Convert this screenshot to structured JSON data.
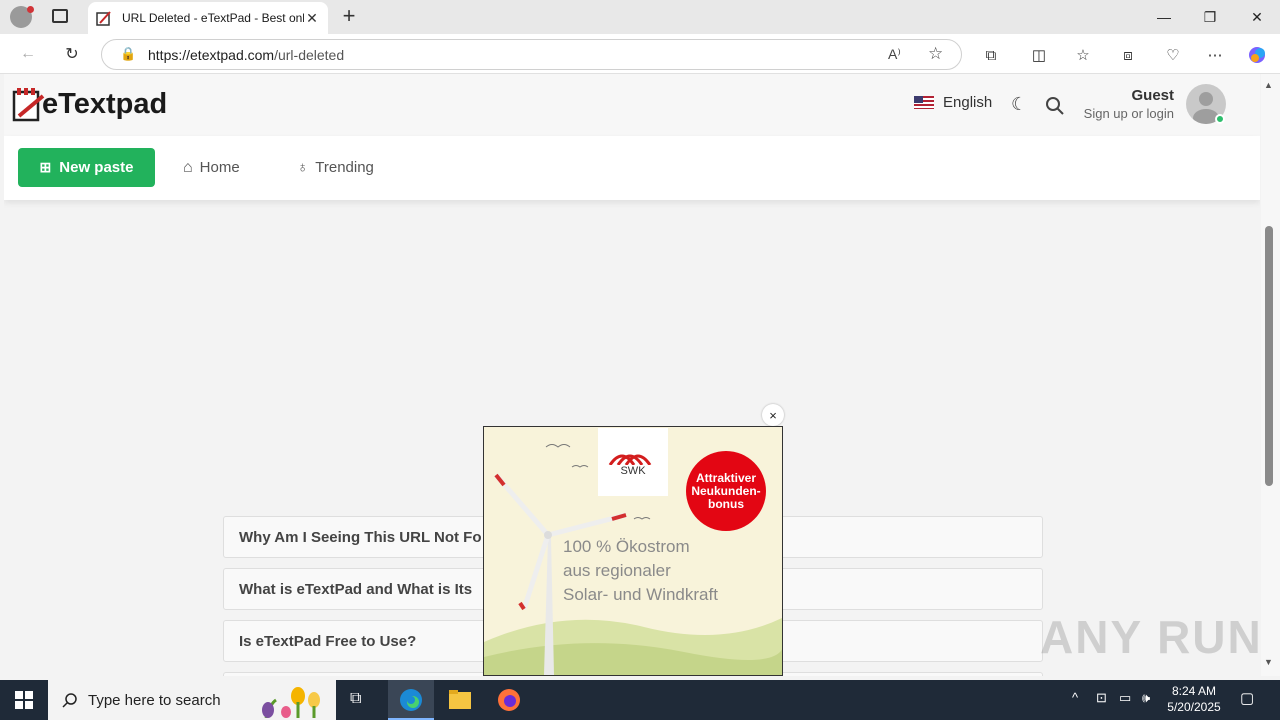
{
  "browser": {
    "tab_title": "URL Deleted - eTextPad - Best onl",
    "new_tab_symbol": "+",
    "url_host": "https://etextpad.com",
    "url_path": "/url-deleted"
  },
  "header": {
    "logo_text": "eTextpad",
    "language": "English",
    "user_name": "Guest",
    "user_sub": "Sign up or login"
  },
  "navbar": {
    "new_paste_label": "New paste",
    "home_label": "Home",
    "trending_label": "Trending"
  },
  "faq": [
    {
      "text": "Why Am I Seeing This URL Not Fo"
    },
    {
      "text": "What is eTextPad and What is Its"
    },
    {
      "text": "Is eTextPad Free to Use?"
    }
  ],
  "ad": {
    "brand": "SWK",
    "badge_line1": "Attraktiver",
    "badge_line2": "Neukunden-",
    "badge_line3": "bonus",
    "line1": "100 % Ökostrom",
    "line2": "aus regionaler",
    "line3": "Solar- und Windkraft",
    "close_symbol": "×"
  },
  "taskbar": {
    "search_placeholder": "Type here to search",
    "time": "8:24 AM",
    "date": "5/20/2025"
  },
  "watermark": "ANY RUN",
  "colors": {
    "accent_green": "#22b25c",
    "ad_red": "#e30613",
    "taskbar": "#1f2a38"
  }
}
